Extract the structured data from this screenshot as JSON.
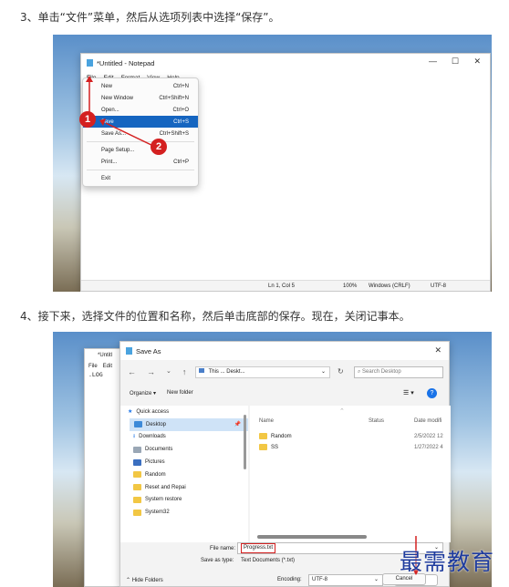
{
  "step3": "3、单击“文件”菜单，然后从选项列表中选择“保存”。",
  "step4": "4、接下来，选择文件的位置和名称，然后单击底部的保存。现在，关闭记事本。",
  "notepad": {
    "title": "*Untitled - Notepad",
    "min": "—",
    "max": "☐",
    "close": "✕",
    "menus": [
      "File",
      "Edit",
      "Format",
      "View",
      "Help"
    ],
    "items": [
      {
        "label": "New",
        "shortcut": "Ctrl+N"
      },
      {
        "label": "New Window",
        "shortcut": "Ctrl+Shift+N"
      },
      {
        "label": "Open...",
        "shortcut": "Ctrl+O"
      },
      {
        "label": "Save",
        "shortcut": "Ctrl+S"
      },
      {
        "label": "Save As...",
        "shortcut": "Ctrl+Shift+S"
      },
      {
        "label": "Page Setup...",
        "shortcut": ""
      },
      {
        "label": "Print...",
        "shortcut": "Ctrl+P"
      },
      {
        "label": "Exit",
        "shortcut": ""
      }
    ],
    "badge1": "1",
    "badge2": "2",
    "status": {
      "pos": "Ln 1, Col 5",
      "zoom": "100%",
      "eol": "Windows (CRLF)",
      "enc": "UTF-8"
    }
  },
  "saveas": {
    "bg_title": "*Untitl",
    "bg_menu": [
      "File",
      "Edit"
    ],
    "bg_text": ".LOG",
    "title": "Save As",
    "close": "✕",
    "path": "This ... Deskt...",
    "search_placeholder": "Search Desktop",
    "organize": "Organize ▾",
    "newfolder": "New folder",
    "nav": [
      "Quick access",
      "Desktop",
      "Downloads",
      "Documents",
      "Pictures",
      "Random",
      "Reset and Repai",
      "System restore",
      "System32"
    ],
    "columns": {
      "name": "Name",
      "status": "Status",
      "date": "Date modifi"
    },
    "files": [
      {
        "name": "Random",
        "date": "2/5/2022 12"
      },
      {
        "name": "SS",
        "date": "1/27/2022 4"
      }
    ],
    "filename_label": "File name:",
    "filename": "Progress.txt",
    "type_label": "Save as type:",
    "type": "Text Documents (*.txt)",
    "hide": "Hide Folders",
    "encoding_label": "Encoding:",
    "encoding": "UTF-8",
    "save": "Save",
    "cancel": "Cancel"
  },
  "watermark": "最需教育"
}
